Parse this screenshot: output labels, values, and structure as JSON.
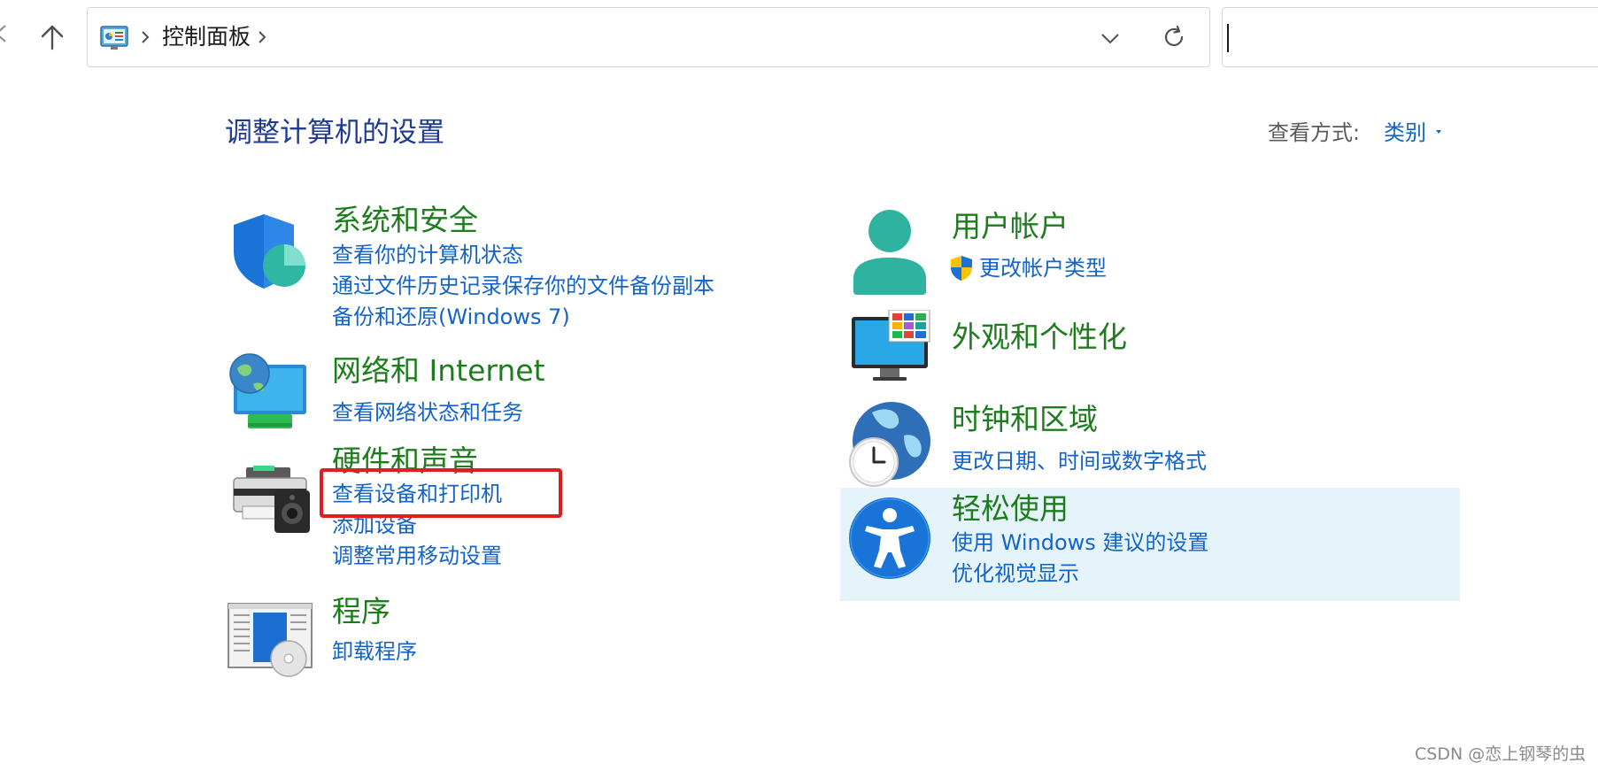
{
  "address": {
    "breadcrumb": "控制面板"
  },
  "content": {
    "title": "调整计算机的设置",
    "view_by_label": "查看方式:",
    "view_by_value": "类别",
    "categories": [
      {
        "title": "系统和安全",
        "icon": "shield-icon",
        "links": [
          "查看你的计算机状态",
          "通过文件历史记录保存你的文件备份副本",
          "备份和还原(Windows 7)"
        ]
      },
      {
        "title": "网络和 Internet",
        "icon": "network-icon",
        "links": [
          "查看网络状态和任务"
        ]
      },
      {
        "title": "硬件和声音",
        "icon": "printer-speaker-icon",
        "links": [
          "查看设备和打印机",
          "添加设备",
          "调整常用移动设置"
        ]
      },
      {
        "title": "程序",
        "icon": "programs-icon",
        "links": [
          "卸载程序"
        ]
      },
      {
        "title": "用户帐户",
        "icon": "user-icon",
        "links": [
          "更改帐户类型"
        ]
      },
      {
        "title": "外观和个性化",
        "icon": "monitor-icon",
        "links": []
      },
      {
        "title": "时钟和区域",
        "icon": "globe-clock-icon",
        "links": [
          "更改日期、时间或数字格式"
        ]
      },
      {
        "title": "轻松使用",
        "icon": "accessibility-icon",
        "links": [
          "使用 Windows 建议的设置",
          "优化视觉显示"
        ]
      }
    ]
  },
  "colors": {
    "category_title": "#1d7d1d",
    "link": "#1464c8",
    "page_title": "#1f3a93",
    "annotation": "#e01e1e",
    "hover_highlight": "#e5f3fb"
  },
  "watermark": "CSDN @恋上钢琴的虫"
}
